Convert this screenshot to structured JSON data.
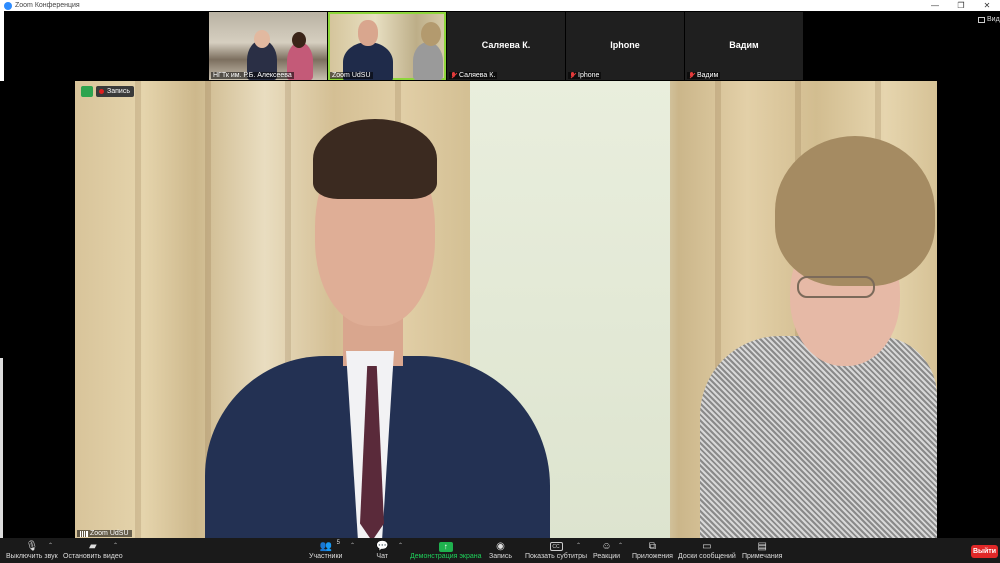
{
  "window": {
    "title": "Zoom Конференция",
    "controls": [
      "—",
      "❐",
      "✕"
    ]
  },
  "view_button": {
    "label": "Вид"
  },
  "thumbnails": [
    {
      "name": "НГТк им. Р.Б. Алексеева",
      "muted": false,
      "type": "video"
    },
    {
      "name": "Zoom UdSU",
      "muted": false,
      "type": "video",
      "active": true
    },
    {
      "name": "Саляева К.",
      "display_name": "Саляева К.",
      "muted": true,
      "type": "avatar"
    },
    {
      "name": "Iphone",
      "display_name": "Iphone",
      "muted": true,
      "type": "avatar"
    },
    {
      "name": "Вадим",
      "display_name": "Вадим",
      "muted": true,
      "type": "avatar"
    }
  ],
  "main_video": {
    "recording_label": "Запись",
    "speaker_label": "Zoom UdSU"
  },
  "toolbar": {
    "mute": "Выключить звук",
    "stop_video": "Остановить видео",
    "participants": "Участники",
    "participants_count": "5",
    "chat": "Чат",
    "share": "Демонстрация экрана",
    "record": "Запись",
    "captions": "Показать субтитры",
    "captions_icon": "CC",
    "reactions": "Реакции",
    "apps": "Приложения",
    "whiteboards": "Доски сообщений",
    "notes": "Примечания",
    "leave": "Выйти"
  },
  "colors": {
    "active_speaker": "#8dd63a",
    "share_green": "#1fb14e",
    "leave_red": "#e02828",
    "muted_red": "#e23b3b"
  }
}
